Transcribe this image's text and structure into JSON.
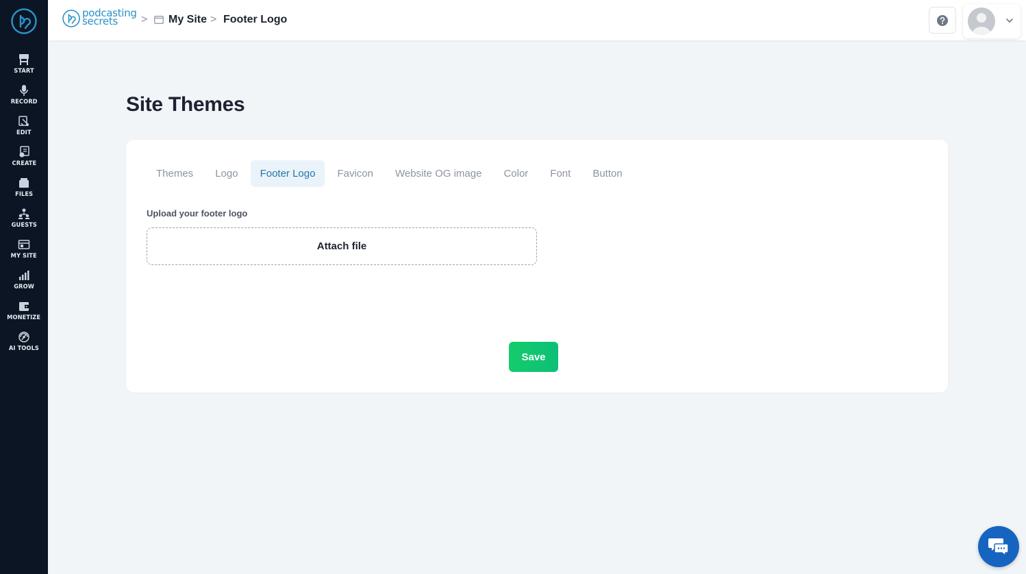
{
  "sidebar": {
    "items": [
      {
        "label": "START",
        "icon": "start-icon"
      },
      {
        "label": "RECORD",
        "icon": "microphone-icon"
      },
      {
        "label": "EDIT",
        "icon": "edit-icon"
      },
      {
        "label": "CREATE",
        "icon": "create-icon"
      },
      {
        "label": "FILES",
        "icon": "files-icon"
      },
      {
        "label": "GUESTS",
        "icon": "guests-icon"
      },
      {
        "label": "MY SITE",
        "icon": "site-icon"
      },
      {
        "label": "GROW",
        "icon": "chart-icon"
      },
      {
        "label": "MONETIZE",
        "icon": "monetize-icon"
      },
      {
        "label": "AI TOOLS",
        "icon": "ai-tools-icon"
      }
    ]
  },
  "header": {
    "brand_line1": "podcasting",
    "brand_line2": "secrets",
    "breadcrumb": {
      "parent": "My Site",
      "current": "Footer Logo",
      "separator": ">"
    }
  },
  "main": {
    "title": "Site Themes",
    "tabs": [
      {
        "label": "Themes",
        "active": false
      },
      {
        "label": "Logo",
        "active": false
      },
      {
        "label": "Footer Logo",
        "active": true
      },
      {
        "label": "Favicon",
        "active": false
      },
      {
        "label": "Website OG image",
        "active": false
      },
      {
        "label": "Color",
        "active": false
      },
      {
        "label": "Font",
        "active": false
      },
      {
        "label": "Button",
        "active": false
      }
    ],
    "upload_label": "Upload your footer logo",
    "attach_label": "Attach file",
    "save_label": "Save"
  },
  "colors": {
    "sidebar_bg": "#0c1524",
    "accent": "#2a91c7",
    "save_green": "#14cc6a",
    "chat_blue": "#1565c0"
  }
}
